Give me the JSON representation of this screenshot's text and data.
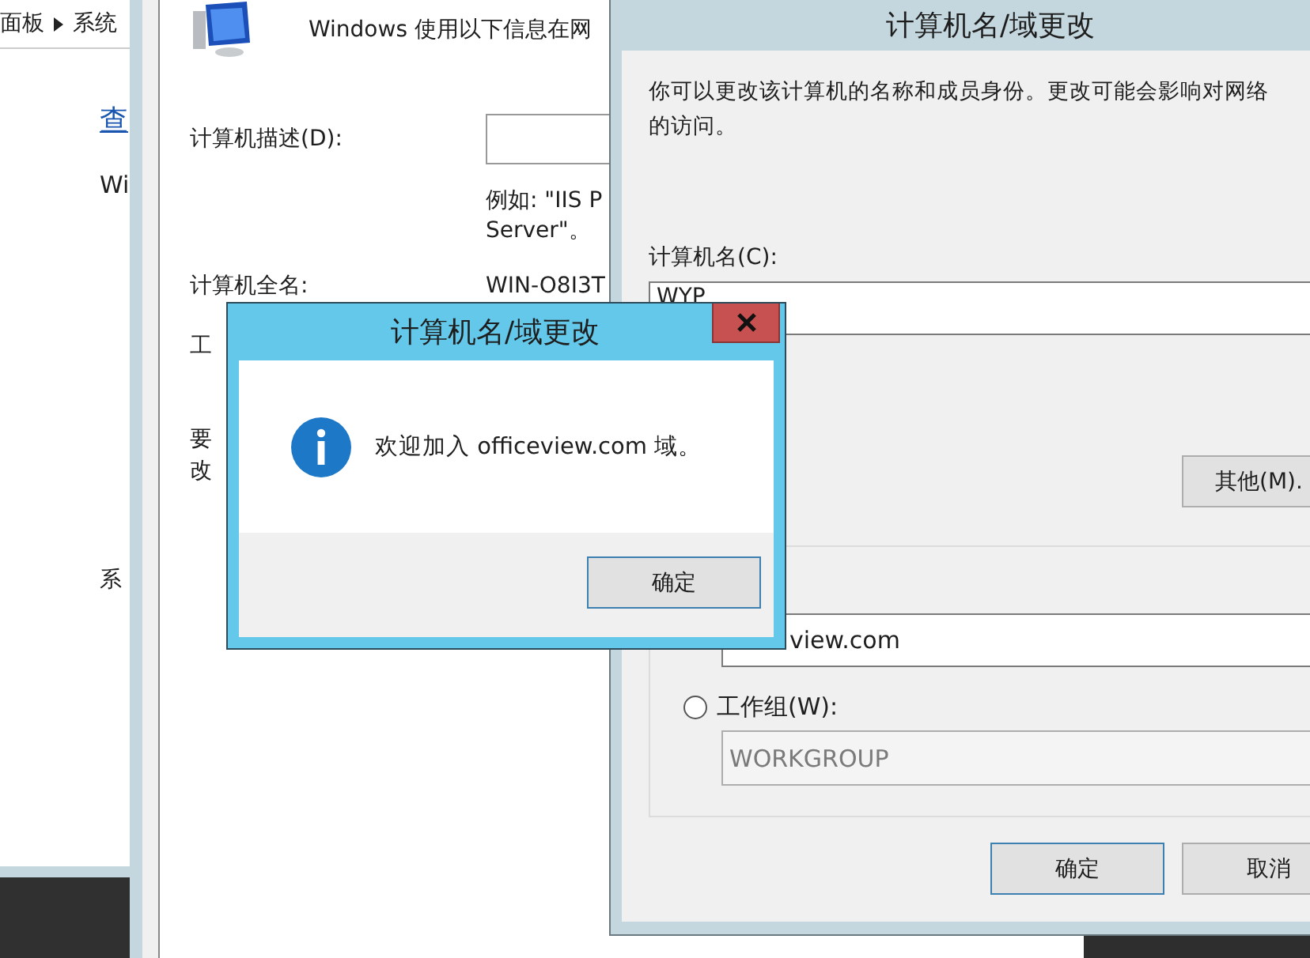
{
  "control_panel": {
    "breadcrumb": [
      "面板",
      "系统"
    ],
    "link": "查",
    "texts": [
      "Wi",
      "系"
    ]
  },
  "system_properties": {
    "intro": "Windows 使用以下信息在网",
    "description_label": "计算机描述(D):",
    "example": [
      "例如: \"IIS P",
      "Server\"。"
    ],
    "full_name_label": "计算机全名:",
    "full_name_value": "WIN-O8I3T",
    "workgroup_label": "工",
    "note": [
      "要",
      "改"
    ]
  },
  "rename_dialog": {
    "title": "计算机名/域更改",
    "description": [
      "你可以更改该计算机的名称和成员身份。更改可能会影响对网络",
      "的访问。"
    ],
    "computer_name_label": "计算机名(C):",
    "computer_name_value": "WYP",
    "more_button": "其他(M).",
    "domain_value": "view.com",
    "workgroup_option": {
      "label": "工作组(W):",
      "selected": false
    },
    "workgroup_value": "WORKGROUP",
    "workgroup_disabled": true,
    "buttons": [
      {
        "label": "确定",
        "default": true
      },
      {
        "label": "取消",
        "default": false
      }
    ]
  },
  "message_box": {
    "title": "计算机名/域更改",
    "message": "欢迎加入 officeview.com 域。",
    "buttons": [
      {
        "label": "确定",
        "default": true
      }
    ]
  }
}
